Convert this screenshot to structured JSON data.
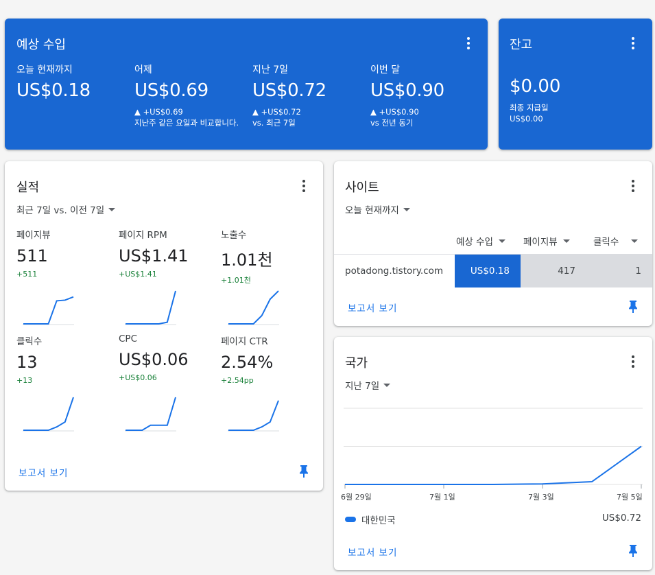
{
  "earnings": {
    "title": "예상 수입",
    "metrics": [
      {
        "label": "오늘 현재까지",
        "value": "US$0.18",
        "change": "",
        "note": ""
      },
      {
        "label": "어제",
        "value": "US$0.69",
        "change": "▲ +US$0.69",
        "note": "지난주 같은 요일과 비교합니다."
      },
      {
        "label": "지난 7일",
        "value": "US$0.72",
        "change": "▲ +US$0.72",
        "note": "vs. 최근 7일"
      },
      {
        "label": "이번 달",
        "value": "US$0.90",
        "change": "▲ +US$0.90",
        "note": "vs 전년 동기"
      }
    ]
  },
  "balance": {
    "title": "잔고",
    "value": "$0.00",
    "last_payment_label": "최종 지급일",
    "last_payment_value": "US$0.00"
  },
  "performance": {
    "title": "실적",
    "range": "최근 7일 vs. 이전 7일",
    "metrics": [
      {
        "label": "페이지뷰",
        "value": "511",
        "change": "+511",
        "trend": [
          0,
          0,
          0,
          0,
          0.7,
          0.72,
          0.82
        ]
      },
      {
        "label": "페이지 RPM",
        "value": "US$1.41",
        "change": "+US$1.41",
        "trend": [
          0,
          0,
          0,
          0,
          0,
          0.05,
          1
        ]
      },
      {
        "label": "노출수",
        "value": "1.01천",
        "change": "+1.01천",
        "trend": [
          0,
          0,
          0,
          0,
          0.25,
          0.75,
          1
        ]
      },
      {
        "label": "클릭수",
        "value": "13",
        "change": "+13",
        "trend": [
          0,
          0,
          0,
          0,
          0.1,
          0.25,
          1
        ]
      },
      {
        "label": "CPC",
        "value": "US$0.06",
        "change": "+US$0.06",
        "trend": [
          0,
          0,
          0,
          0.15,
          0.15,
          0.15,
          1
        ]
      },
      {
        "label": "페이지 CTR",
        "value": "2.54%",
        "change": "+2.54pp",
        "trend": [
          0,
          0,
          0,
          0,
          0.1,
          0.25,
          0.9
        ]
      }
    ],
    "report_link": "보고서 보기"
  },
  "sites": {
    "title": "사이트",
    "range": "오늘 현재까지",
    "columns": [
      "예상 수입",
      "페이지뷰",
      "클릭수"
    ],
    "rows": [
      {
        "site": "potadong.tistory.com",
        "earnings": "US$0.18",
        "pageviews": "417",
        "clicks": "1"
      }
    ],
    "report_link": "보고서 보기"
  },
  "countries": {
    "title": "국가",
    "range": "지난 7일",
    "legend": {
      "name": "대한민국",
      "value": "US$0.72"
    },
    "report_link": "보고서 보기",
    "chart_data": {
      "type": "line",
      "x": [
        "6월 29일",
        "6월 30일",
        "7월 1일",
        "7월 2일",
        "7월 3일",
        "7월 4일",
        "7월 5일"
      ],
      "xticks": [
        "6월 29일",
        "7월 1일",
        "7월 3일",
        "7월 5일"
      ],
      "series": [
        {
          "name": "대한민국",
          "values": [
            0,
            0,
            0,
            0,
            0.002,
            0.01,
            0.14
          ]
        }
      ],
      "ylim": [
        0,
        0.28
      ],
      "grid": true,
      "legend_position": "bottom-left"
    }
  },
  "colors": {
    "primary": "#1967d2",
    "accent": "#1a73e8",
    "positive": "#188038",
    "table_gray": "#dadce0"
  }
}
